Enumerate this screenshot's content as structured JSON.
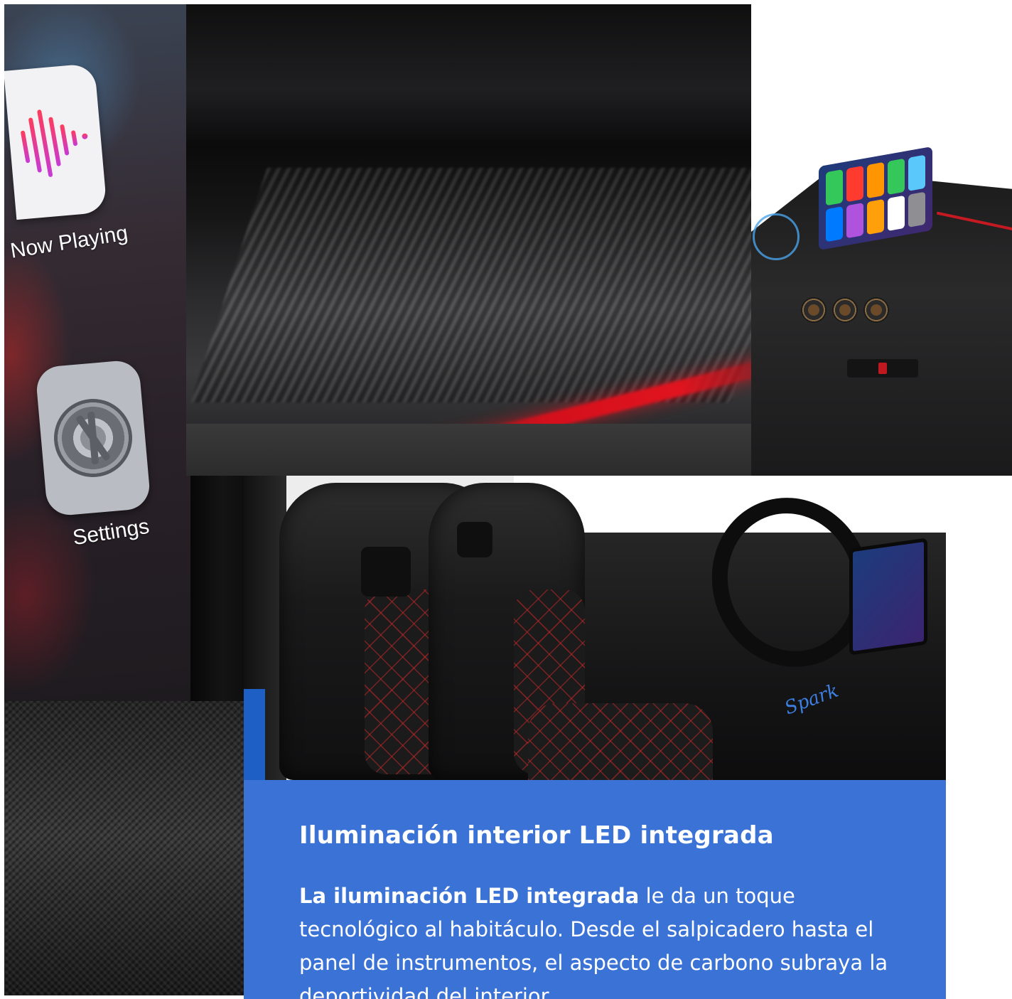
{
  "carplay_screen": {
    "apps": [
      {
        "label": "Now Playing",
        "icon": "now-playing-icon"
      },
      {
        "label": "Settings",
        "icon": "settings-gear-icon"
      }
    ]
  },
  "dashboard_mat_logo": "Spark",
  "feature": {
    "title": "Iluminación interior LED integrada",
    "body_lead": "La iluminación LED integrada",
    "body_rest": " le da un toque tecnológico al habitáculo. Desde el salpicadero hasta el panel de instrumentos, el aspecto de carbono subraya la deportividad del interior."
  },
  "colors": {
    "panel_background": "#3a72d6",
    "led_accent": "#d3101c",
    "text": "#ffffff"
  }
}
